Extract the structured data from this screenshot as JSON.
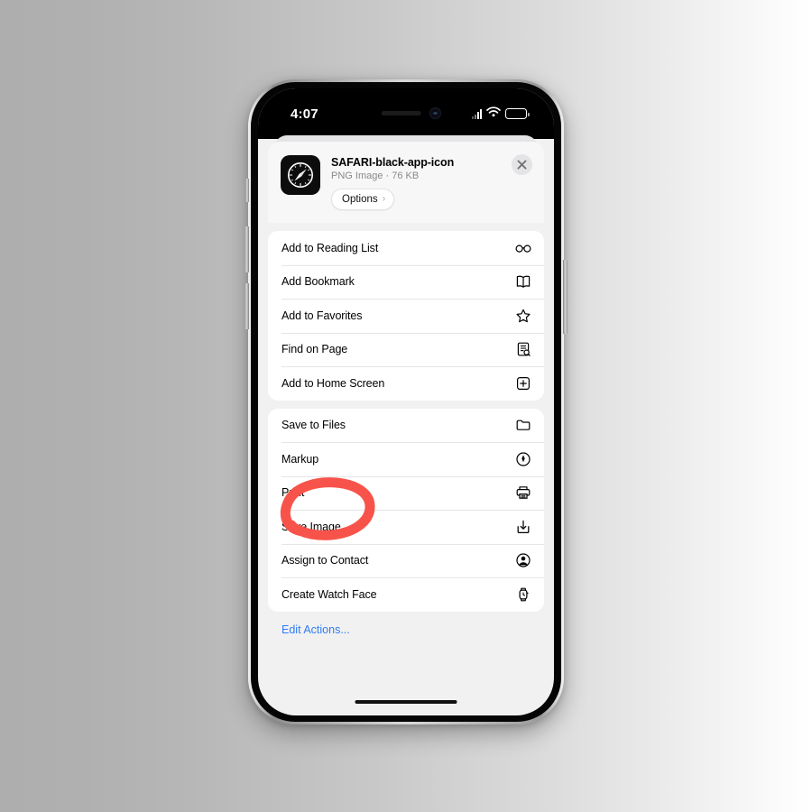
{
  "status_bar": {
    "time": "4:07",
    "cellular_icon": "cellular-bars-icon",
    "wifi_icon": "wifi-icon",
    "battery_icon": "battery-icon"
  },
  "share_sheet": {
    "file_title": "SAFARI-black-app-icon",
    "file_subtitle": "PNG Image · 76 KB",
    "app_icon": "safari-compass-icon",
    "options_label": "Options",
    "options_chevron": "›",
    "close_icon": "close-x-icon",
    "groups": [
      {
        "name": "browsing-actions",
        "items": [
          {
            "label": "Add to Reading List",
            "icon": "glasses-icon"
          },
          {
            "label": "Add Bookmark",
            "icon": "book-icon"
          },
          {
            "label": "Add to Favorites",
            "icon": "star-icon"
          },
          {
            "label": "Find on Page",
            "icon": "find-on-page-icon"
          },
          {
            "label": "Add to Home Screen",
            "icon": "plus-square-icon"
          }
        ]
      },
      {
        "name": "file-actions",
        "items": [
          {
            "label": "Save to Files",
            "icon": "folder-icon"
          },
          {
            "label": "Markup",
            "icon": "markup-pen-icon"
          },
          {
            "label": "Print",
            "icon": "printer-icon"
          },
          {
            "label": "Save Image",
            "icon": "save-download-icon"
          },
          {
            "label": "Assign to Contact",
            "icon": "person-circle-icon"
          },
          {
            "label": "Create Watch Face",
            "icon": "watch-icon"
          }
        ]
      }
    ],
    "edit_actions_label": "Edit Actions..."
  },
  "annotation": {
    "target_label": "Save Image",
    "shape": "hand-drawn-ellipse",
    "color": "#f8534a"
  },
  "colors": {
    "accent_blue": "#2f7cf6",
    "annotation_red": "#f8534a",
    "sheet_background": "#f1f1f1",
    "row_background": "#ffffff"
  }
}
